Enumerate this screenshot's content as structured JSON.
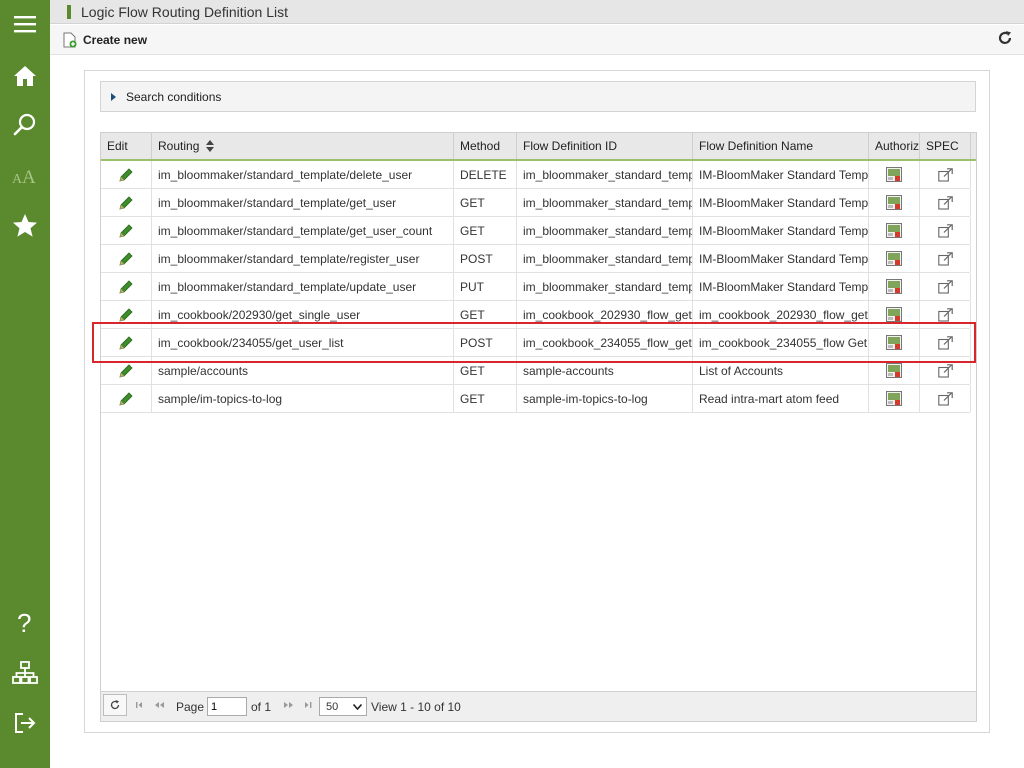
{
  "header": {
    "title": "Logic Flow Routing Definition List"
  },
  "toolbar": {
    "create_label": "Create new"
  },
  "search": {
    "label": "Search conditions"
  },
  "table": {
    "columns": {
      "edit": "Edit",
      "routing": "Routing",
      "method": "Method",
      "flow_id": "Flow Definition ID",
      "flow_name": "Flow Definition Name",
      "auth": "Authoriz",
      "spec": "SPEC"
    },
    "rows": [
      {
        "routing": "im_bloommaker/standard_template/delete_user",
        "method": "DELETE",
        "flow_id": "im_bloommaker_standard_temp",
        "flow_name": "IM-BloomMaker Standard Temp"
      },
      {
        "routing": "im_bloommaker/standard_template/get_user",
        "method": "GET",
        "flow_id": "im_bloommaker_standard_temp",
        "flow_name": "IM-BloomMaker Standard Temp"
      },
      {
        "routing": "im_bloommaker/standard_template/get_user_count",
        "method": "GET",
        "flow_id": "im_bloommaker_standard_temp",
        "flow_name": "IM-BloomMaker Standard Temp"
      },
      {
        "routing": "im_bloommaker/standard_template/register_user",
        "method": "POST",
        "flow_id": "im_bloommaker_standard_temp",
        "flow_name": "IM-BloomMaker Standard Temp"
      },
      {
        "routing": "im_bloommaker/standard_template/update_user",
        "method": "PUT",
        "flow_id": "im_bloommaker_standard_temp",
        "flow_name": "IM-BloomMaker Standard Temp"
      },
      {
        "routing": "im_cookbook/202930/get_single_user",
        "method": "GET",
        "flow_id": "im_cookbook_202930_flow_get",
        "flow_name": "im_cookbook_202930_flow_get"
      },
      {
        "routing": "im_cookbook/234055/get_user_list",
        "method": "POST",
        "flow_id": "im_cookbook_234055_flow_get",
        "flow_name": "im_cookbook_234055_flow Get"
      },
      {
        "routing": "sample/accounts",
        "method": "GET",
        "flow_id": "sample-accounts",
        "flow_name": "List of Accounts"
      },
      {
        "routing": "sample/im-topics-to-log",
        "method": "GET",
        "flow_id": "sample-im-topics-to-log",
        "flow_name": "Read intra-mart atom feed"
      }
    ]
  },
  "pager": {
    "page_label": "Page",
    "page_value": "1",
    "of_label": "of 1",
    "page_size": "50",
    "view_text": "View 1 - 10 of 10"
  },
  "colors": {
    "sidebar": "#5b8a2e",
    "highlight": "#d9262c"
  }
}
